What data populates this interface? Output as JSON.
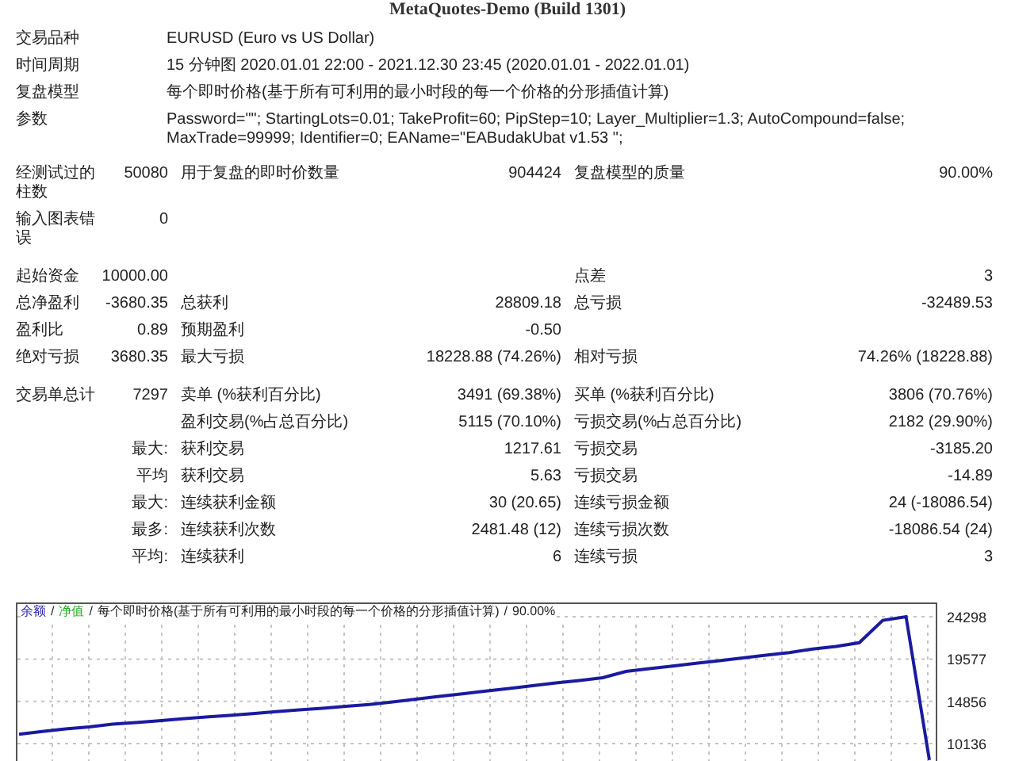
{
  "title": "MetaQuotes-Demo (Build 1301)",
  "info_rows": [
    {
      "label": "交易品种",
      "value": "EURUSD (Euro vs US Dollar)"
    },
    {
      "label": "时间周期",
      "value": "15 分钟图 2020.01.01 22:00 - 2021.12.30 23:45 (2020.01.01 - 2022.01.01)"
    },
    {
      "label": "复盘模型",
      "value": "每个即时价格(基于所有可利用的最小时段的每一个价格的分形插值计算)"
    },
    {
      "label": "参数",
      "value": "Password=\"\"; StartingLots=0.01; TakeProfit=60; PipStep=10; Layer_Multiplier=1.3; AutoCompound=false; MaxTrade=99999; Identifier=0; EAName=\"EABudakUbat v1.53 \";"
    }
  ],
  "summary_rows": [
    {
      "label_1": "经测试过的柱数",
      "value_1": "50080",
      "label_2": "用于复盘的即时价数量",
      "value_2": "904424",
      "label_3": "复盘模型的质量",
      "value_3": "90.00%"
    },
    {
      "label_1": "输入图表错误",
      "value_1": "0"
    }
  ],
  "stats_groups": [
    [
      {
        "label_1": "起始资金",
        "value_1": "10000.00",
        "label_3": "点差",
        "value_3": "3"
      },
      {
        "label_1": "总净盈利",
        "value_1": "-3680.35",
        "label_2": "总获利",
        "value_2": "28809.18",
        "label_3": "总亏损",
        "value_3": "-32489.53"
      },
      {
        "label_1": "盈利比",
        "value_1": "0.89",
        "label_2": "预期盈利",
        "value_2": "-0.50"
      },
      {
        "label_1": "绝对亏损",
        "value_1": "3680.35",
        "label_2": "最大亏损",
        "value_2": "18228.88 (74.26%)",
        "label_3": "相对亏损",
        "value_3": "74.26% (18228.88)"
      }
    ],
    [
      {
        "label_1": "交易单总计",
        "value_1": "7297",
        "label_2": "卖单 (%获利百分比)",
        "value_2": "3491 (69.38%)",
        "label_3": "买单 (%获利百分比)",
        "value_3": "3806 (70.76%)"
      },
      {
        "label_2": "盈利交易(%占总百分比)",
        "value_2": "5115 (70.10%)",
        "label_3": "亏损交易(%占总百分比)",
        "value_3": "2182 (29.90%)"
      },
      {
        "value_1": "最大:",
        "label_2": "获利交易",
        "value_2": "1217.61",
        "label_3": "亏损交易",
        "value_3": "-3185.20"
      },
      {
        "value_1": "平均",
        "label_2": "获利交易",
        "value_2": "5.63",
        "label_3": "亏损交易",
        "value_3": "-14.89"
      },
      {
        "value_1": "最大:",
        "label_2": "连续获利金额",
        "value_2": "30 (20.65)",
        "label_3": "连续亏损金额",
        "value_3": "24 (-18086.54)"
      },
      {
        "value_1": "最多:",
        "label_2": "连续获利次数",
        "value_2": "2481.48 (12)",
        "label_3": "连续亏损次数",
        "value_3": "-18086.54 (24)"
      },
      {
        "value_1": "平均:",
        "label_2": "连续获利",
        "value_2": "6",
        "label_3": "连续亏损",
        "value_3": "3"
      }
    ]
  ],
  "chart": {
    "legend": [
      {
        "text": "/",
        "color": "#222222"
      },
      {
        "text": "净值",
        "color": "#22b022"
      },
      {
        "text": "/",
        "color": "#222222"
      },
      {
        "text": "每个即时价格(基于所有可利用的最小时段的每一个价格的分形插值计算)",
        "color": "#222222"
      },
      {
        "text": "/",
        "color": "#222222"
      },
      {
        "text": "90.00%",
        "color": "#222222"
      }
    ],
    "chart_data": {
      "type": "line",
      "grid": true,
      "ylim": [
        8200,
        25900
      ],
      "yticks": [
        24298,
        19577,
        14856,
        10136
      ],
      "series": [
        {
          "name": "余额",
          "color": "#1a1aa0",
          "values": [
            11200,
            11500,
            11800,
            12000,
            12300,
            12500,
            12700,
            12900,
            13100,
            13300,
            13500,
            13700,
            13900,
            14100,
            14300,
            14500,
            14800,
            15100,
            15400,
            15700,
            16000,
            16300,
            16600,
            16900,
            17200,
            17500,
            18200,
            18500,
            18800,
            19100,
            19400,
            19700,
            20000,
            20300,
            20700,
            21000,
            21400,
            23900,
            24300,
            8300
          ]
        }
      ]
    }
  }
}
